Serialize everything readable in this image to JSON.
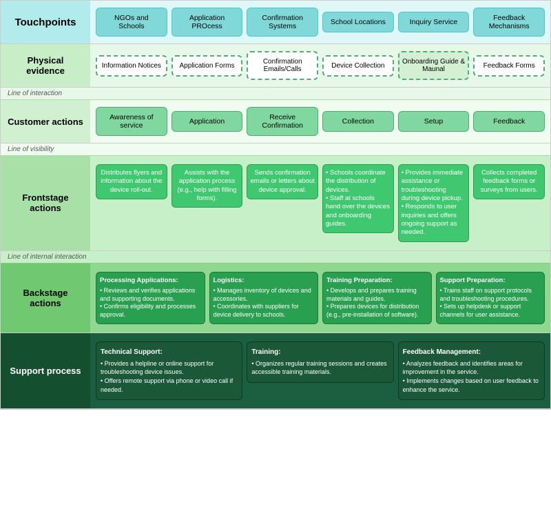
{
  "rows": {
    "touchpoints": {
      "label": "Touchpoints",
      "items": [
        {
          "text": "NGOs and Schools"
        },
        {
          "text": "Application PROcess"
        },
        {
          "text": "Confirmation Systems"
        },
        {
          "text": "School Locations"
        },
        {
          "text": "Inquiry Service"
        },
        {
          "text": "Feedback Mechanisms"
        }
      ]
    },
    "physical": {
      "label": "Physical evidence",
      "items": [
        {
          "text": "Information Notices"
        },
        {
          "text": "Application Forms"
        },
        {
          "text": "Confirmation Emails/Calls"
        },
        {
          "text": "Device Collection"
        },
        {
          "text": "Onboarding Guide & Maunal"
        },
        {
          "text": "Feedback Forms"
        }
      ]
    },
    "lines": {
      "interaction": "Line of interaction",
      "visibility": "Line of visibility",
      "internal": "Line of internal interaction"
    },
    "customer": {
      "label": "Customer actions",
      "items": [
        {
          "text": "Awareness of service"
        },
        {
          "text": "Application"
        },
        {
          "text": "Receive Confirmation"
        },
        {
          "text": "Collection"
        },
        {
          "text": "Setup"
        },
        {
          "text": "Feedback"
        }
      ]
    },
    "frontstage": {
      "label": "Frontstage actions",
      "items": [
        {
          "text": "Distributes flyers and information about the device roll-out."
        },
        {
          "text": "Assists with the application process (e.g., help with filling forms)."
        },
        {
          "text": "Sends confirmation emails or letters about device approval."
        },
        {
          "text": "• Schools coordinate the distribution of devices.\n• Staff at schools hand over the devices and onboarding guides."
        },
        {
          "text": "• Provides immediate assistance or troubleshooting during device pickup.\n• Responds to user inquiries and offers ongoing support as needed."
        },
        {
          "text": "Collects completed feedback forms or surveys from users."
        }
      ]
    },
    "backstage": {
      "label": "Backstage actions",
      "items": [
        {
          "title": "Processing Applications:",
          "text": "• Reviews and verifies applications and supporting documents.\n• Confirms eligibility and processes approval."
        },
        {
          "title": "Logistics:",
          "text": "• Manages inventory of devices and accessories.\n• Coordinates with suppliers for device delivery to schools."
        },
        {
          "title": "Training Preparation:",
          "text": "• Develops and prepares training materials and guides.\n• Prepares devices for distribution (e.g., pre-installation of software)."
        },
        {
          "title": "Support Preparation:",
          "text": "• Trains staff on support protocols and troubleshooting procedures.\n• Sets up helpdesk or support channels for user assistance."
        }
      ]
    },
    "support": {
      "label": "Support process",
      "items": [
        {
          "title": "Technical Support:",
          "text": "• Provides a helpline or online support for troubleshooting device issues.\n• Offers remote support via phone or video call if needed."
        },
        {
          "title": "Training:",
          "text": "• Organizes regular training sessions and creates accessible training materials."
        },
        {
          "title": "Feedback Management:",
          "text": "• Analyzes feedback and identifies areas for improvement in the service.\n• Implements changes based on user feedback to enhance the service."
        }
      ]
    }
  }
}
